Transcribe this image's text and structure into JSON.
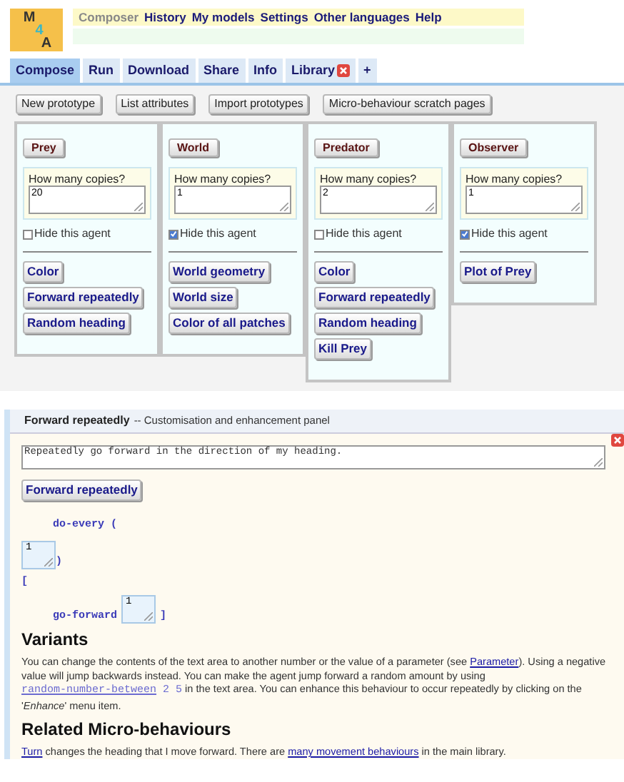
{
  "logo": [
    "M",
    "4",
    "A"
  ],
  "nav": [
    {
      "label": "Composer",
      "selected": true
    },
    {
      "label": "History",
      "selected": false
    },
    {
      "label": "My models",
      "selected": false
    },
    {
      "label": "Settings",
      "selected": false
    },
    {
      "label": "Other languages",
      "selected": false
    },
    {
      "label": "Help",
      "selected": false
    }
  ],
  "tabs": [
    {
      "label": "Compose",
      "selected": true,
      "closable": false
    },
    {
      "label": "Run",
      "selected": false,
      "closable": false
    },
    {
      "label": "Download",
      "selected": false,
      "closable": false
    },
    {
      "label": "Share",
      "selected": false,
      "closable": false
    },
    {
      "label": "Info",
      "selected": false,
      "closable": false
    },
    {
      "label": "Library",
      "selected": false,
      "closable": true
    },
    {
      "label": "+",
      "selected": false,
      "closable": false
    }
  ],
  "toolbar": [
    "New prototype",
    "List attributes",
    "Import prototypes",
    "Micro-behaviour scratch pages"
  ],
  "agents": [
    {
      "name": "Prey",
      "copies_label": "How many copies?",
      "copies": "20",
      "hide_label": "Hide this agent",
      "hidden": false,
      "behaviours": [
        "Color",
        "Forward repeatedly",
        "Random heading"
      ]
    },
    {
      "name": "World",
      "copies_label": "How many copies?",
      "copies": "1",
      "hide_label": "Hide this agent",
      "hidden": true,
      "behaviours": [
        "World geometry",
        "World size",
        "Color of all patches"
      ]
    },
    {
      "name": "Predator",
      "copies_label": "How many copies?",
      "copies": "2",
      "hide_label": "Hide this agent",
      "hidden": false,
      "behaviours": [
        "Color",
        "Forward repeatedly",
        "Random heading",
        "Kill Prey"
      ]
    },
    {
      "name": "Observer",
      "copies_label": "How many copies?",
      "copies": "1",
      "hide_label": "Hide this agent",
      "hidden": true,
      "behaviours": [
        "Plot of Prey"
      ]
    }
  ],
  "panel": {
    "title": "Forward repeatedly",
    "subtitle": "-- Customisation and enhancement panel",
    "description": "Repeatedly go forward in the direction of my heading.",
    "button": "Forward repeatedly",
    "code": [
      {
        "kind": "keyword",
        "text": "do-every ("
      },
      {
        "kind": "field",
        "value": "1",
        "after": ")"
      },
      {
        "kind": "bracket",
        "text": "["
      },
      {
        "kind": "keyword_field",
        "text": "go-forward",
        "value": "1",
        "after": "]"
      }
    ],
    "sections": [
      {
        "heading": "Variants",
        "paragraph": [
          {
            "kind": "text",
            "text": "You can change the contents of the text area to another number or the value of a parameter (see "
          },
          {
            "kind": "link",
            "text": "Parameter"
          },
          {
            "kind": "text",
            "text": "). Using a negative value will jump backwards instead. You can make the agent jump forward a random amount by using "
          },
          {
            "kind": "code_link",
            "text": "random-number-between"
          },
          {
            "kind": "code",
            "text": " 2 5"
          },
          {
            "kind": "text",
            "text": " in the text area. You can enhance this behaviour to occur repeatedly by clicking on the '"
          },
          {
            "kind": "italic",
            "text": "Enhance"
          },
          {
            "kind": "text",
            "text": "' menu item."
          }
        ]
      },
      {
        "heading": "Related Micro-behaviours",
        "paragraph": [
          {
            "kind": "link",
            "text": "Turn"
          },
          {
            "kind": "text",
            "text": " changes the heading that I move forward. There are "
          },
          {
            "kind": "link",
            "text": "many movement behaviours"
          },
          {
            "kind": "text",
            "text": " in the main library."
          }
        ]
      }
    ]
  }
}
